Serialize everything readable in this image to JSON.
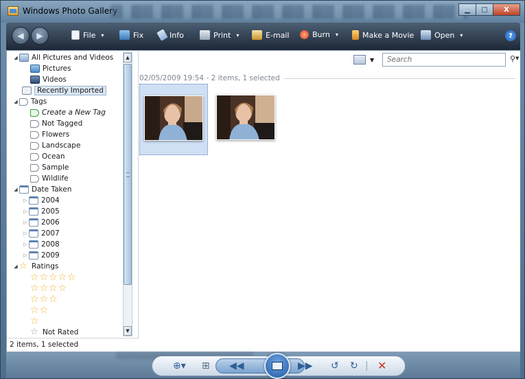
{
  "window": {
    "title": "Windows Photo Gallery",
    "buttons": {
      "minimize": "▁",
      "maximize": "□",
      "close": "X"
    }
  },
  "toolbar": {
    "items": [
      {
        "label": "File",
        "icon": "file-icon",
        "caret": "▾"
      },
      {
        "label": "Fix",
        "icon": "fix-icon"
      },
      {
        "label": "Info",
        "icon": "info-icon"
      },
      {
        "label": "Print",
        "icon": "printer-icon",
        "caret": "▾"
      },
      {
        "label": "E-mail",
        "icon": "email-icon"
      },
      {
        "label": "Burn",
        "icon": "burn-icon",
        "caret": "▾"
      },
      {
        "label": "Make a Movie",
        "icon": "movie-icon"
      },
      {
        "label": "Open",
        "icon": "open-icon",
        "caret": "▾"
      }
    ],
    "help": "?"
  },
  "navigation": {
    "all_pictures": "All Pictures and Videos",
    "pictures": "Pictures",
    "videos": "Videos",
    "recently_imported": "Recently Imported",
    "tags": "Tags",
    "create_tag": "Create a New Tag",
    "not_tagged": "Not Tagged",
    "tag_items": [
      "Flowers",
      "Landscape",
      "Ocean",
      "Sample",
      "Wildlife"
    ],
    "date_taken": "Date Taken",
    "years": [
      "2004",
      "2005",
      "2006",
      "2007",
      "2008",
      "2009"
    ],
    "ratings": "Ratings",
    "rating_levels": [
      5,
      4,
      3,
      2,
      1
    ],
    "not_rated": "Not Rated"
  },
  "status": {
    "text": "2 items, 1 selected"
  },
  "main": {
    "search_placeholder": "Search",
    "group_header": "02/05/2009 19:54 - 2 items, 1 selected",
    "photos": [
      {
        "selected": true
      },
      {
        "selected": false
      }
    ]
  },
  "colors": {
    "toolbar_bg": "#1d2836",
    "selection": "#cfe0f4",
    "accent": "#2e5e96"
  }
}
